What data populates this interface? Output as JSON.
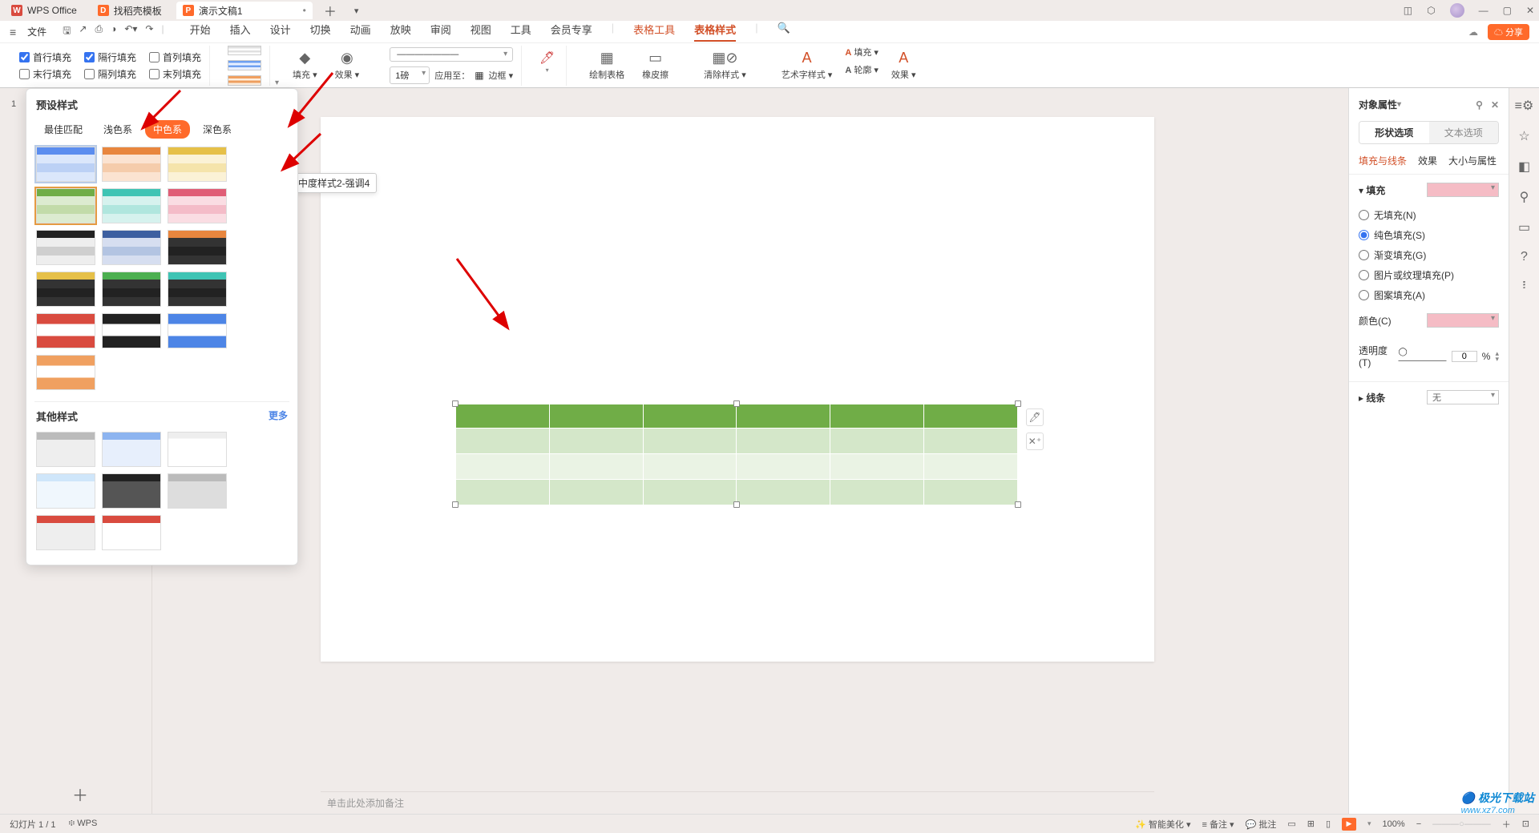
{
  "titlebar": {
    "tabs": [
      {
        "label": "WPS Office",
        "icon_bg": "#d94b3f",
        "icon_txt": "W"
      },
      {
        "label": "找稻壳模板",
        "icon_bg": "#ff6a2b",
        "icon_txt": "D"
      },
      {
        "label": "演示文稿1",
        "icon_bg": "#ff6a2b",
        "icon_txt": "P",
        "active": true,
        "closable": true
      }
    ]
  },
  "menubar": {
    "file": "文件",
    "tabs": [
      "开始",
      "插入",
      "设计",
      "切换",
      "动画",
      "放映",
      "审阅",
      "视图",
      "工具",
      "会员专享",
      "表格工具",
      "表格样式"
    ],
    "share": "分享"
  },
  "ribbon": {
    "checks_row1": [
      {
        "label": "首行填充",
        "checked": true
      },
      {
        "label": "隔行填充",
        "checked": true
      },
      {
        "label": "首列填充",
        "checked": false
      }
    ],
    "checks_row2": [
      {
        "label": "末行填充",
        "checked": false
      },
      {
        "label": "隔列填充",
        "checked": false
      },
      {
        "label": "末列填充",
        "checked": false
      }
    ],
    "fill": "填充",
    "effect": "效果",
    "linewidth": "1磅",
    "applyto": "应用至：",
    "border": "边框",
    "drawtable": "绘制表格",
    "eraser": "橡皮擦",
    "clearstyle": "清除样式",
    "wordart": "艺术字样式",
    "outline": "轮廓",
    "effect2": "效果"
  },
  "dropdown": {
    "title1": "预设样式",
    "tabs": [
      "最佳匹配",
      "浅色系",
      "中色系",
      "深色系"
    ],
    "title2": "其他样式",
    "more": "更多",
    "tooltip": "中度样式2-强调4"
  },
  "canvas": {
    "notes_placeholder": "单击此处添加备注"
  },
  "rightpanel": {
    "title": "对象属性",
    "tabA": "形状选项",
    "tabB": "文本选项",
    "subtabs": [
      "填充与线条",
      "效果",
      "大小与属性"
    ],
    "fill_header": "填充",
    "radios": [
      "无填充(N)",
      "纯色填充(S)",
      "渐变填充(G)",
      "图片或纹理填充(P)",
      "图案填充(A)"
    ],
    "color_lbl": "颜色(C)",
    "opacity_lbl": "透明度(T)",
    "opacity_val": "0",
    "opacity_unit": "%",
    "line_header": "线条",
    "line_val": "无"
  },
  "statusbar": {
    "slide": "幻灯片 1 / 1",
    "wps": "WPS",
    "beauty": "智能美化",
    "notes": "备注",
    "comments": "批注",
    "zoom": "100%"
  },
  "watermark1": "极光下载站",
  "watermark2": "www.xz7.com"
}
